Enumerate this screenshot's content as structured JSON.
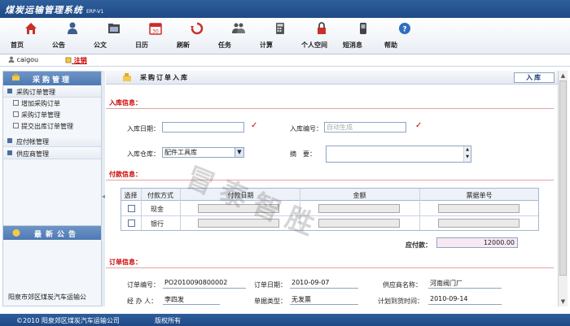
{
  "app": {
    "title": "煤炭运输管理系统",
    "version": "ERP-V1"
  },
  "toolbar": {
    "items": [
      {
        "label": "首页",
        "icon": "home-icon"
      },
      {
        "label": "公告",
        "icon": "users-icon"
      },
      {
        "label": "公文",
        "icon": "folder-icon"
      },
      {
        "label": "日历",
        "icon": "calendar-icon"
      },
      {
        "label": "刷新",
        "icon": "refresh-icon"
      },
      {
        "label": "任务",
        "icon": "task-icon"
      },
      {
        "label": "计算",
        "icon": "calculator-icon"
      },
      {
        "label": "个人空间",
        "icon": "lock-icon"
      },
      {
        "label": "短消息",
        "icon": "phone-icon"
      },
      {
        "label": "帮助",
        "icon": "help-icon"
      }
    ]
  },
  "userbar": {
    "user": "caigou",
    "logout": "注销"
  },
  "sidebar": {
    "title": "采购管理",
    "groups": [
      {
        "label": "采购订单管理",
        "items": [
          "增加采购订单",
          "采购订单管理",
          "提交出库订单管理"
        ]
      },
      {
        "label": "应付帐管理",
        "items": []
      },
      {
        "label": "供应商管理",
        "items": []
      }
    ]
  },
  "notice": {
    "title": "最新公告",
    "text": "阳泉市郊区煤炭汽车运输公"
  },
  "page": {
    "title": "采购订单入库",
    "tag": "入库"
  },
  "instock": {
    "section": "入库信息：",
    "date_label": "入库日期：",
    "date_value": "",
    "no_label": "入库编号：",
    "no_placeholder": "自动生成",
    "warehouse_label": "入库仓库：",
    "warehouse_value": "配件工具库",
    "memo_label": "摘　要：",
    "memo_value": ""
  },
  "payment": {
    "section": "付款信息：",
    "headers": [
      "选择",
      "付款方式",
      "付款日期",
      "金额",
      "票据单号"
    ],
    "rows": [
      {
        "method": "现金"
      },
      {
        "method": "银行"
      }
    ],
    "total_label": "应付款：",
    "total_value": "12000.00"
  },
  "order": {
    "section": "订单信息：",
    "no_label": "订单编号：",
    "no_value": "PO2010090800002",
    "date_label": "订单日期：",
    "date_value": "2010-09-07",
    "supplier_label": "供应商名称：",
    "supplier_value": "河南阀门厂",
    "handler_label": "经 办 人：",
    "handler_value": "李四发",
    "bill_label": "单据类型：",
    "bill_value": "无发票",
    "plan_label": "计划到货时间：",
    "plan_value": "2010-09-14"
  },
  "footer": {
    "copyright": "©2010  阳泉郊区煤炭汽车运输公司",
    "rights": "版权所有"
  },
  "watermark": "冒泰智胜",
  "colors": {
    "header": "#2e5e9c",
    "section": "#cc0000",
    "accent": "#4d79b3"
  }
}
